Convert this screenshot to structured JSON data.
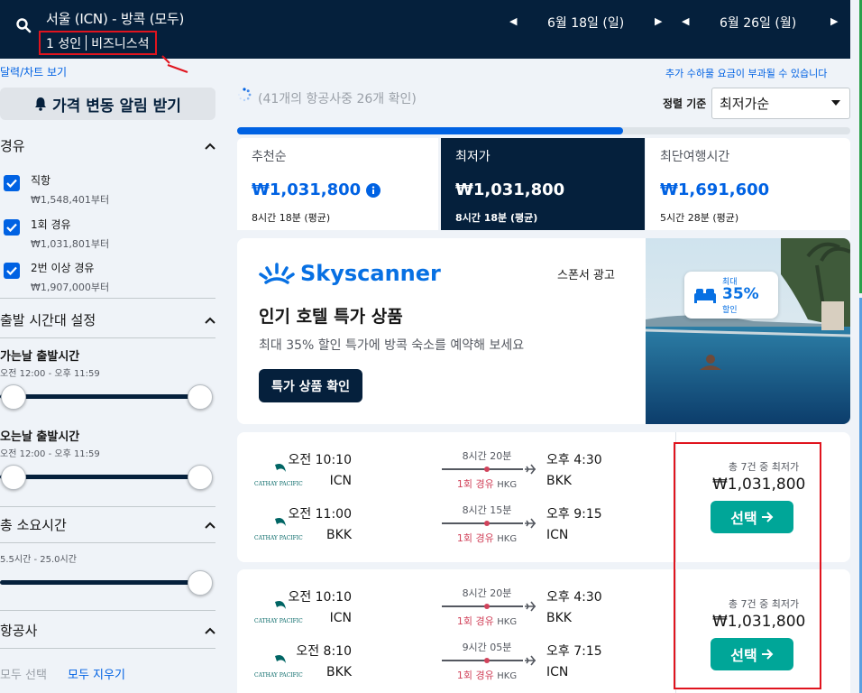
{
  "header": {
    "route": "서울 (ICN) - 방콕 (모두)",
    "passengers": "1 성인",
    "cabin": "비즈니스석",
    "depart_date": "6월 18일 (일)",
    "return_date": "6월 26일 (월)"
  },
  "sidebar": {
    "calendar_link": "달력/차트 보기",
    "price_alert": "가격 변동 알림 받기",
    "stops": {
      "title": "경유",
      "options": [
        {
          "label": "직항",
          "price": "₩1,548,401부터"
        },
        {
          "label": "1회 경유",
          "price": "₩1,031,801부터"
        },
        {
          "label": "2번 이상 경유",
          "price": "₩1,907,000부터"
        }
      ]
    },
    "departure_times": {
      "title": "출발 시간대 설정",
      "outbound_label": "가는날 출발시간",
      "outbound_range": "오전 12:00 - 오후 11:59",
      "return_label": "오는날 출발시간",
      "return_range": "오전 12:00 - 오후 11:59"
    },
    "duration": {
      "title": "총 소요시간",
      "range": "5.5시간 - 25.0시간"
    },
    "airlines": {
      "title": "항공사",
      "select_all": "모두 선택",
      "clear_all": "모두 지우기"
    }
  },
  "main": {
    "status": "(41개의 항공사중 26개 확인)",
    "surcharge_notice": "추가 수하물 요금이 부과될 수 있습니다",
    "sort_label": "정렬 기준",
    "sort_value": "최저가순",
    "progress_pct": 63,
    "tabs": [
      {
        "title": "추천순",
        "price": "₩1,031,800",
        "sub": "8시간 18분 (평균)"
      },
      {
        "title": "최저가",
        "price": "₩1,031,800",
        "sub": "8시간 18분 (평균)"
      },
      {
        "title": "최단여행시간",
        "price": "₩1,691,600",
        "sub": "5시간 28분 (평균)"
      }
    ],
    "ad": {
      "brand": "Skyscanner",
      "sponsor": "스폰서 광고",
      "title": "인기 호텔 특가 상품",
      "description": "최대 35% 할인 특가에 방콕 숙소를 예약해 보세요",
      "button": "특가 상품 확인",
      "badge_top": "최대",
      "badge_pct": "35%",
      "badge_bottom": "할인"
    },
    "results": [
      {
        "price_meta": "총 7건 중 최저가",
        "price": "₩1,031,800",
        "button": "선택",
        "legs": [
          {
            "airline": "CATHAY PACIFIC",
            "dep_time": "오전 10:10",
            "dep_airport": "ICN",
            "duration": "8시간 20분",
            "stops": "1회 경유",
            "via": "HKG",
            "arr_time": "오후 4:30",
            "arr_airport": "BKK"
          },
          {
            "airline": "CATHAY PACIFIC",
            "dep_time": "오전 11:00",
            "dep_airport": "BKK",
            "duration": "8시간 15분",
            "stops": "1회 경유",
            "via": "HKG",
            "arr_time": "오후 9:15",
            "arr_airport": "ICN"
          }
        ]
      },
      {
        "price_meta": "총 7건 중 최저가",
        "price": "₩1,031,800",
        "button": "선택",
        "legs": [
          {
            "airline": "CATHAY PACIFIC",
            "dep_time": "오전 10:10",
            "dep_airport": "ICN",
            "duration": "8시간 20분",
            "stops": "1회 경유",
            "via": "HKG",
            "arr_time": "오후 4:30",
            "arr_airport": "BKK"
          },
          {
            "airline": "CATHAY PACIFIC",
            "dep_time": "오전 8:10",
            "dep_airport": "BKK",
            "duration": "9시간 05분",
            "stops": "1회 경유",
            "via": "HKG",
            "arr_time": "오후 7:15",
            "arr_airport": "ICN"
          }
        ]
      }
    ]
  }
}
